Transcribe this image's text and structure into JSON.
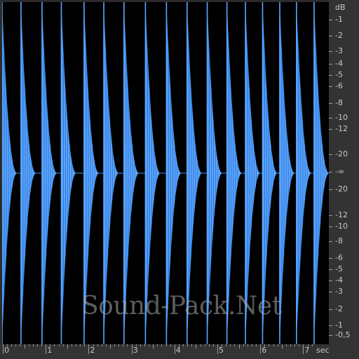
{
  "app": {
    "view": "waveform-display",
    "colors": {
      "waveform": "#3d8ff5",
      "waveform_light": "#5aa5ff",
      "background": "#000000",
      "ruler": "#333333",
      "text": "#c8c8c8"
    }
  },
  "waveform": {
    "duration_sec": 7.6,
    "hits_sec": [
      0.0,
      0.44,
      0.93,
      1.38,
      1.91,
      2.37,
      2.84,
      3.34,
      3.83,
      4.31,
      4.78,
      5.24,
      5.67,
      6.07,
      6.47,
      6.86,
      7.27
    ],
    "decay_tail_sec": 0.35
  },
  "db_scale": {
    "unit_label": "dB",
    "upper_labels": [
      "-1",
      "-2",
      "-3",
      "-4",
      "-5",
      "-6",
      "-8",
      "-10",
      "-12",
      "-20"
    ],
    "center_label": "-∞",
    "lower_labels": [
      "-20",
      "-12",
      "-10",
      "-8",
      "-6",
      "-5",
      "-4",
      "-3",
      "-2",
      "-1",
      "-0,5"
    ]
  },
  "time_scale": {
    "labels": [
      "0",
      "1",
      "2",
      "3",
      "4",
      "5",
      "6",
      "7"
    ],
    "unit_label": "sec"
  },
  "watermark": {
    "text": "Sound-Pack.Net"
  }
}
